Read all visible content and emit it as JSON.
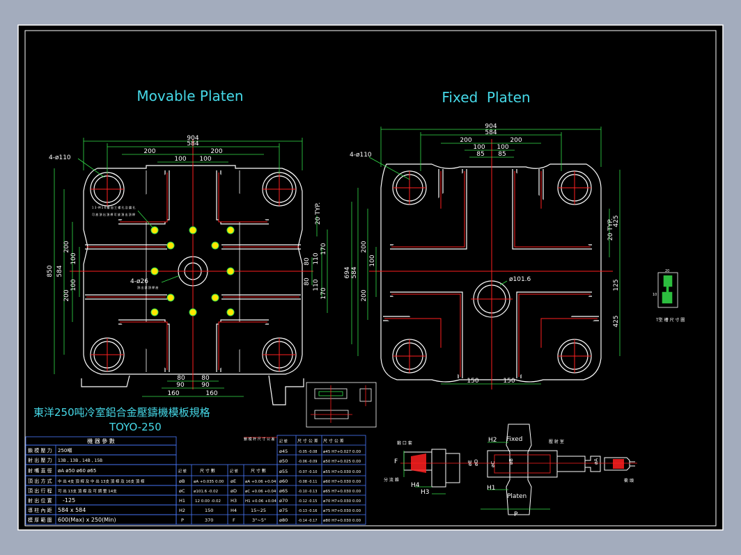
{
  "titles": {
    "movable": "Movable Platen",
    "fixed": "Fixed  Platen",
    "chinese_spec": "東洋250吨冷室鋁合金壓鑄機模板規格",
    "model": "TOYO-250"
  },
  "colors": {
    "background": "#a3acbd",
    "frame": "#000000",
    "geometry": "#ffffff",
    "dimension": "#34e04a",
    "center_line": "#ff2020",
    "title": "#46d9e8",
    "hole_fill": "#ffe600"
  },
  "movable_dims": {
    "overall": "904",
    "inner": "584",
    "half_left": "200",
    "half_right": "200",
    "h100a": "100",
    "h100b": "100",
    "holes": "4-ø110",
    "v850": "850",
    "v584": "584",
    "v200a": "200",
    "v100a": "100",
    "v100b": "100",
    "v200b": "200",
    "r20": "20 TYP.",
    "r170a": "170",
    "r110a": "110",
    "r80a": "80",
    "r80b": "80",
    "r110b": "110",
    "r170b": "170",
    "small_holes": "4-ø26",
    "b80a": "80",
    "b80b": "80",
    "b90a": "90",
    "b90b": "90",
    "b160a": "160",
    "b160b": "160",
    "note1": "1 3 -M 1 6 精 加 工 螺 孔 及 鑄 孔",
    "note2": "可 放 頂 出 頂 桿 可 放 頂 出 頂 桿",
    "note3": "頂 出 部 頂 桿 座"
  },
  "fixed_dims": {
    "overall": "904",
    "inner": "584",
    "half_left": "200",
    "half_right": "200",
    "h100a": "100",
    "h100b": "100",
    "h85a": "85",
    "h85b": "85",
    "holes": "4-ø110",
    "v694": "694",
    "v584": "584",
    "v200a": "200",
    "v100": "100",
    "v200b": "200",
    "r20": "20 TYP.",
    "r425a": "425",
    "r125": "125",
    "r425b": "425",
    "center_hole": "ø101.6",
    "b150a": "150",
    "b150b": "150"
  },
  "tslot": {
    "label": "T型 槽 尺 寸 圖",
    "d1": "20",
    "d2": "10"
  },
  "spec_table": {
    "header": "機 器 參 數",
    "rows": [
      {
        "label": "鎖 模 壓 力",
        "value": "250噸"
      },
      {
        "label": "射 出 壓 力",
        "value": "13B , 13B , 14B , 15B"
      },
      {
        "label": "射 嘴 直 徑",
        "value": "øA ø50 ø60 ø65"
      },
      {
        "label": "頂 出 方 式",
        "value": "中 出 4支 頂 桿 及 中 出 13支 頂 桿 及 16支 頂 桿"
      },
      {
        "label": "頂 出 行 程",
        "value": "可 出 13支 頂 桿 及 可 調 整 14支"
      },
      {
        "label": "射 出 位 置",
        "value": "-125"
      },
      {
        "label": "導 柱 內 距",
        "value": "584 x 584"
      },
      {
        "label": "模 厚 範 圍",
        "value": "600(Max) x 250(Min)"
      }
    ],
    "col_headers": [
      "記 號",
      "尺 寸 數",
      "記 號",
      "尺 寸 數"
    ],
    "sym_rows": [
      [
        "øB",
        "øA +0.035 0.00",
        "øE",
        "øA +0.06 +0.04"
      ],
      [
        "øC",
        "ø101.6 -0.02",
        "øD",
        "øC +0.06 +0.04"
      ],
      [
        "H1",
        "12 0.00 -0.02",
        "H3",
        "H1 +0.06 +0.04"
      ],
      [
        "H2",
        "150",
        "H4",
        "15~25"
      ],
      [
        "P",
        "370",
        "F",
        "3°~5°"
      ]
    ]
  },
  "tol_table": {
    "title": "鎖 模 杆 尺 寸 公 差",
    "headers": [
      "記 號",
      "尺 寸 公 差",
      "尺 寸 公 差"
    ],
    "rows": [
      [
        "ø45",
        "-0.05 -0.08",
        "ø45 H7+0.027 0.00"
      ],
      [
        "ø50",
        "-0.06 -0.09",
        "ø50 H7+0.025 0.00"
      ],
      [
        "ø55",
        "-0.07 -0.10",
        "ø55 H7+0.030 0.00"
      ],
      [
        "ø60",
        "-0.08 -0.11",
        "ø60 H7+0.030 0.00"
      ],
      [
        "ø65",
        "-0.10 -0.13",
        "ø65 H7+0.030 0.00"
      ],
      [
        "ø70",
        "-0.12 -0.15",
        "ø70 H7+0.030 0.00"
      ],
      [
        "ø75",
        "-0.13 -0.16",
        "ø75 H7+0.030 0.00"
      ],
      [
        "ø80",
        "-0.14 -0.17",
        "ø80 H7+0.030 0.00"
      ]
    ]
  },
  "detail": {
    "fixed": "Fixed",
    "platen": "Platen",
    "H1": "H1",
    "H2": "H2",
    "H3": "H3",
    "H4": "H4",
    "P": "P",
    "F": "F",
    "phiA": "øA",
    "phiB": "øB",
    "phiC": "øC",
    "phiD": "øD",
    "phiE": "øE",
    "note_a": "鍛 口 套",
    "note_b": "分 流 錐",
    "note_c": "壓 射 室",
    "note_d": "衝 頭"
  }
}
